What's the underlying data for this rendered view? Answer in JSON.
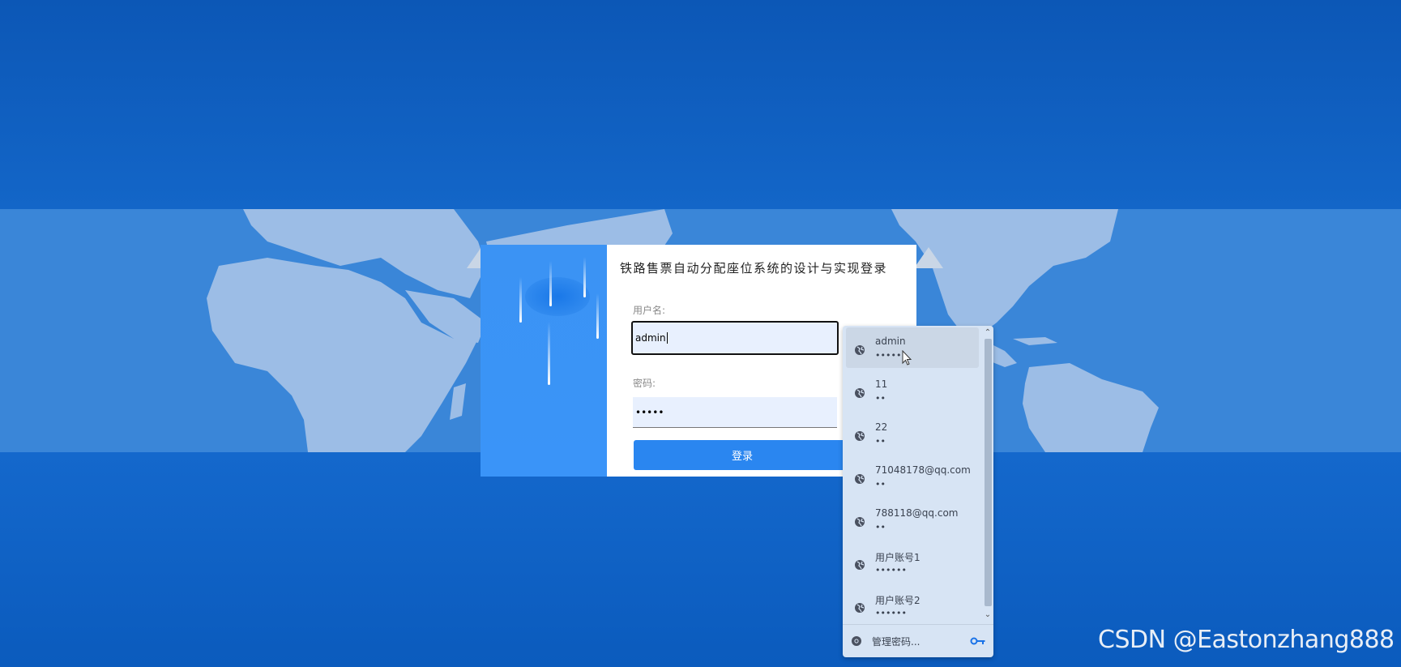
{
  "app": {
    "title": "铁路售票自动分配座位系统的设计与实现登录"
  },
  "form": {
    "username_label": "用户名:",
    "username_value": "admin",
    "password_label": "密码:",
    "password_value": "•••••",
    "login_button": "登录"
  },
  "autofill": {
    "items": [
      {
        "user": "admin",
        "pass": "•••••"
      },
      {
        "user": "11",
        "pass": "••"
      },
      {
        "user": "22",
        "pass": "••"
      },
      {
        "user": "71048178@qq.com",
        "pass": "••"
      },
      {
        "user": "788118@qq.com",
        "pass": "••"
      },
      {
        "user": "用户账号1",
        "pass": "••••••"
      },
      {
        "user": "用户账号2",
        "pass": "••••••"
      }
    ],
    "manage_label": "管理密码..."
  },
  "watermark": "CSDN @Eastonzhang888",
  "colors": {
    "background": "#1060c0",
    "map_band": "#3a86d8",
    "card_accent": "#3a94f8",
    "button": "#2a86f0",
    "autofill_bg": "#d7e4f4"
  }
}
